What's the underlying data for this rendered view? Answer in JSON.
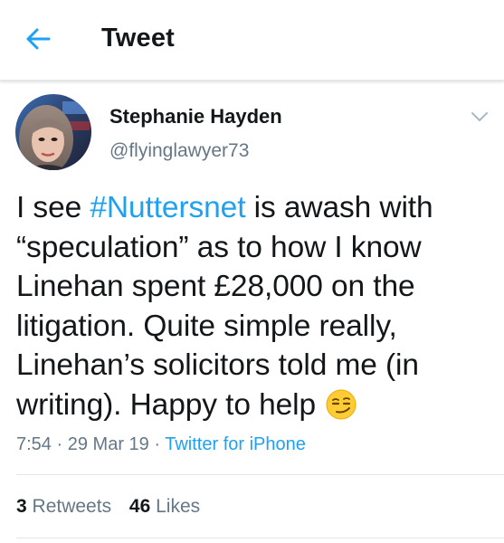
{
  "header": {
    "title": "Tweet",
    "back_icon": "arrow-left-icon"
  },
  "tweet": {
    "author": {
      "display_name": "Stephanie Hayden",
      "handle": "@flyinglawyer73"
    },
    "text": {
      "line1_pre": "I see ",
      "hashtag": "#Nuttersnet",
      "line1_post": " is awash with",
      "line2": "“speculation” as to how I know",
      "line3": "Linehan spent £28,000 on the",
      "line4": "litigation. Quite simple really,",
      "line5": "Linehan’s solicitors told me (in",
      "line6": "writing). Happy to help",
      "emoji": "smirking-face-emoji"
    },
    "time": "7:54",
    "separator": "·",
    "date": "29 Mar 19",
    "source": "Twitter for iPhone",
    "retweets": {
      "count": "3",
      "label": "Retweets"
    },
    "likes": {
      "count": "46",
      "label": "Likes"
    }
  },
  "colors": {
    "accent": "#1da1f2",
    "text_primary": "#14171a",
    "text_secondary": "#657786",
    "divider": "#e1e8ed"
  }
}
